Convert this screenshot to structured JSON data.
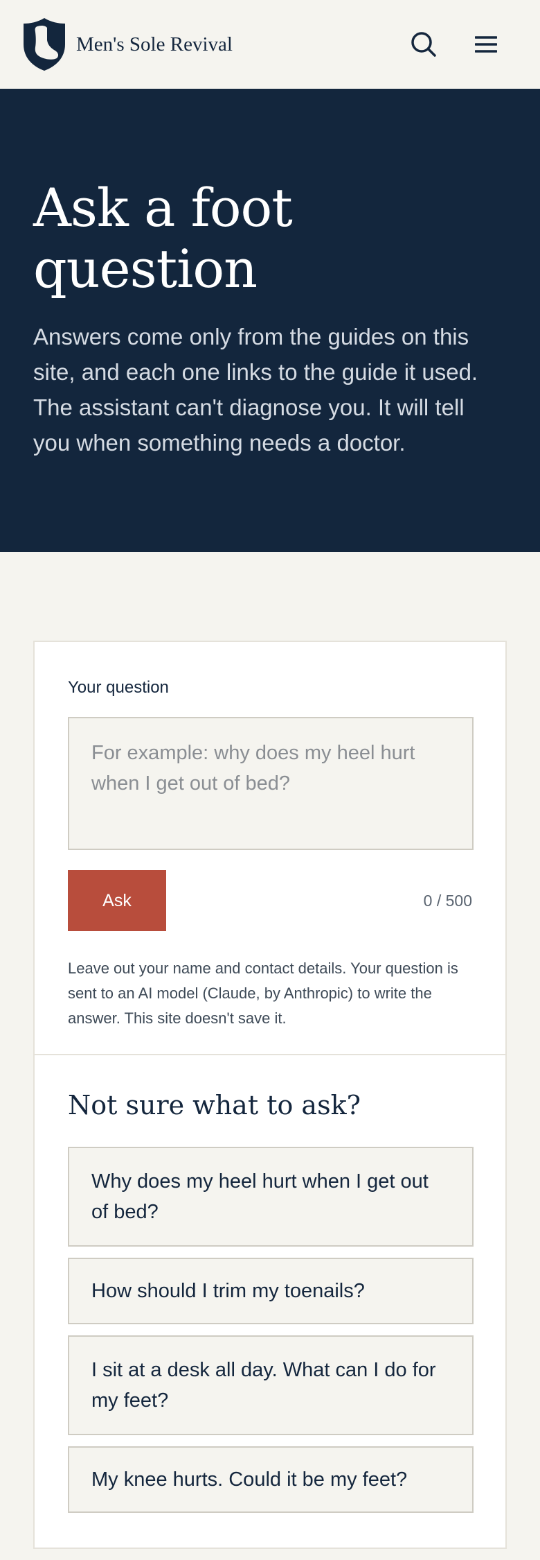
{
  "header": {
    "brand": "Men's Sole Revival",
    "logo_icon": "foot-shield-icon",
    "search_icon": "search-icon",
    "menu_icon": "hamburger-menu-icon"
  },
  "hero": {
    "title": "Ask a foot question",
    "description": "Answers come only from the guides on this site, and each one links to the guide it used. The assistant can't diagnose you. It will tell you when something needs a doctor."
  },
  "form": {
    "label": "Your question",
    "placeholder": "For example: why does my heel hurt when I get out of bed?",
    "value": "",
    "ask_label": "Ask",
    "counter": "0 / 500",
    "disclaimer": "Leave out your name and contact details. Your question is sent to an AI model (Claude, by Anthropic) to write the answer. This site doesn't save it."
  },
  "suggestions": {
    "title": "Not sure what to ask?",
    "items": [
      "Why does my heel hurt when I get out of bed?",
      "How should I trim my toenails?",
      "I sit at a desk all day. What can I do for my feet?",
      "My knee hurts. Could it be my feet?"
    ]
  },
  "colors": {
    "navy": "#13263d",
    "accent": "#b84d3c",
    "background": "#f5f4ef"
  }
}
